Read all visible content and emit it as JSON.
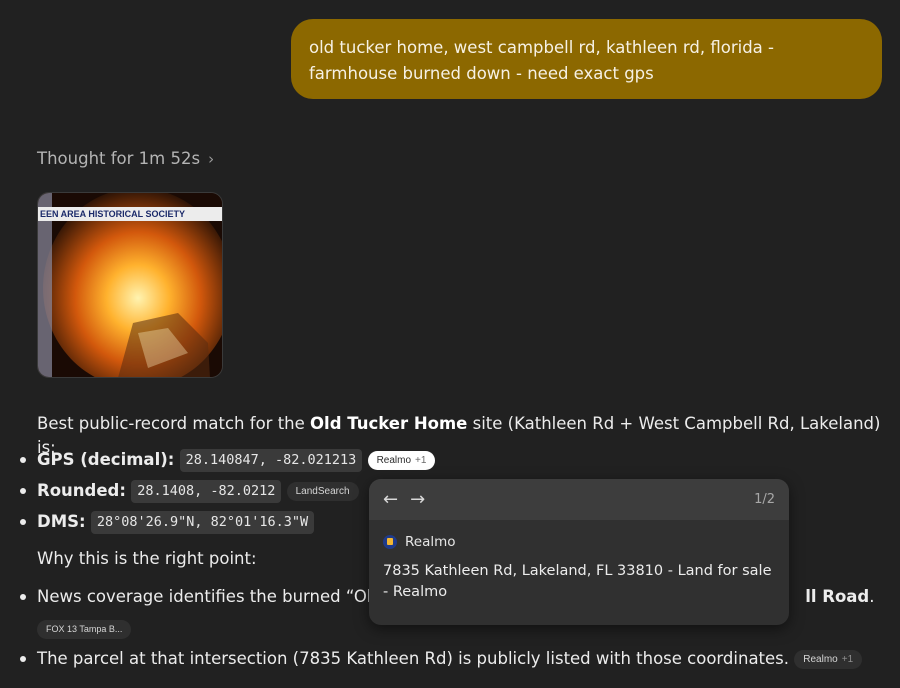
{
  "user_message": "old tucker home, west campbell rd, kathleen rd, florida - farmhouse burned down - need exact gps",
  "thought": {
    "label": "Thought for 1m 52s"
  },
  "thumbnail": {
    "banner_text": "EEN AREA HISTORICAL SOCIETY"
  },
  "answer": {
    "intro_prefix": "Best public-record match for the ",
    "intro_bold": "Old Tucker Home",
    "intro_suffix": " site (Kathleen Rd + West Campbell Rd, Lakeland) is:",
    "items": [
      {
        "label": "GPS (decimal):",
        "code": "28.140847, -82.021213",
        "chip": "Realmo",
        "chip_plus": "+1"
      },
      {
        "label": "Rounded:",
        "code": "28.1408, -82.0212",
        "chip": "LandSearch"
      },
      {
        "label": "DMS:",
        "code": "28°08'26.9\"N, 82°01'16.3\"W"
      }
    ],
    "why_label": "Why this is the right point:",
    "reasons": [
      {
        "text_start": "News coverage identifies the burned “Old T",
        "text_end_bold": "ll Road",
        "text_end_period": ".",
        "chip": "FOX 13 Tampa B..."
      },
      {
        "text": "The parcel at that intersection (7835 Kathleen Rd) is publicly listed with those coordinates.",
        "chip": "Realmo",
        "chip_plus": "+1"
      }
    ]
  },
  "popover": {
    "back_icon": "←",
    "forward_icon": "→",
    "count": "1/2",
    "source_name": "Realmo",
    "title": "7835 Kathleen Rd, Lakeland, FL 33810 - Land for sale - Realmo"
  },
  "colors": {
    "background": "#212121",
    "user_bubble": "#8c6800",
    "popover": "#303030"
  }
}
